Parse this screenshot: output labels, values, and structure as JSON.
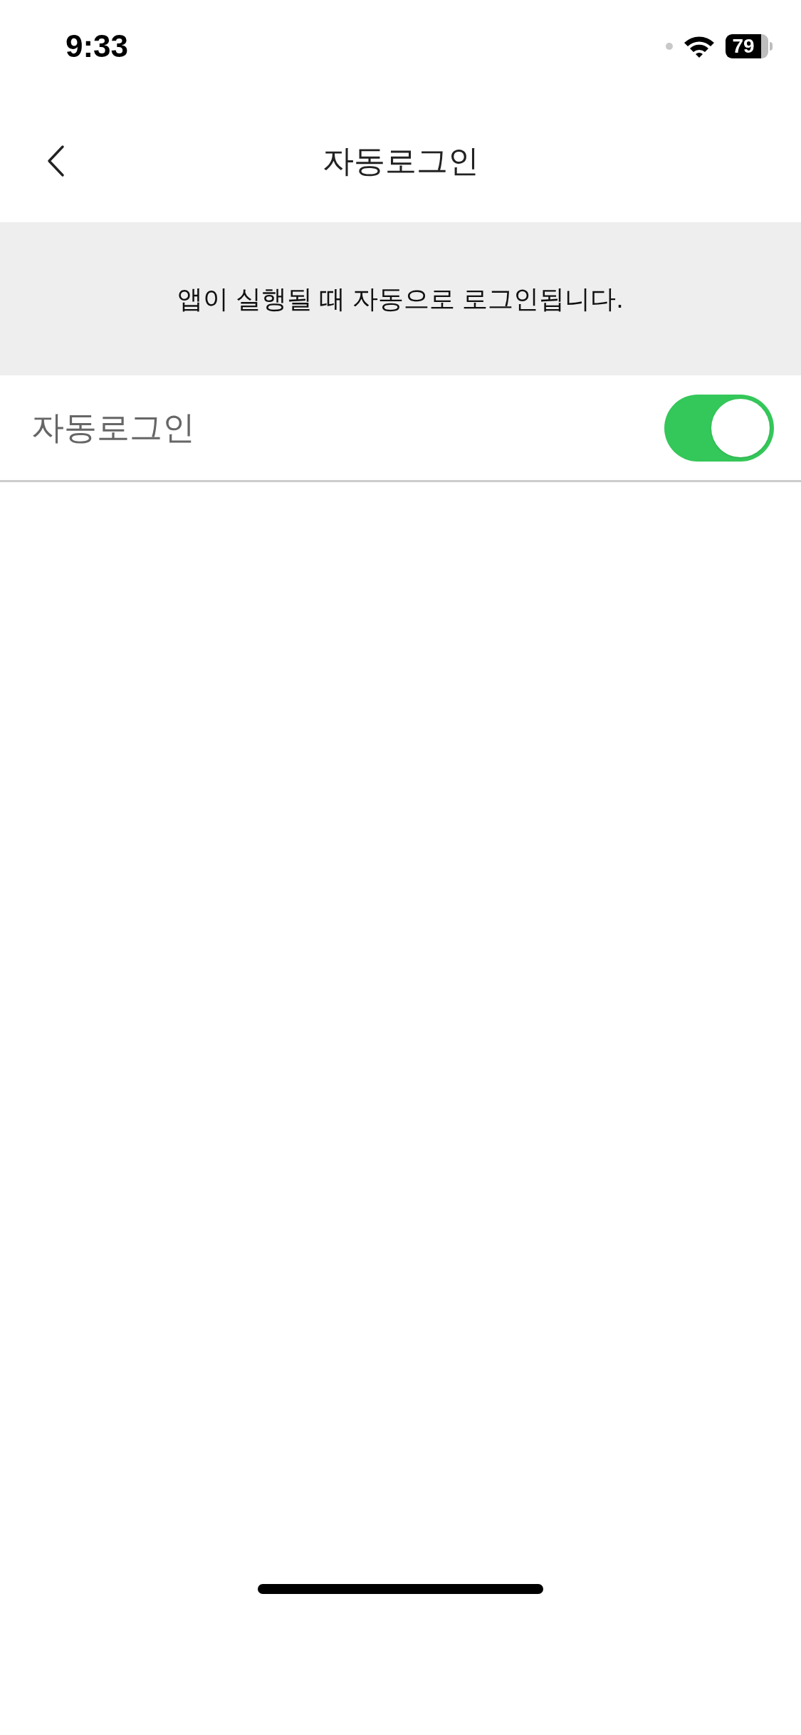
{
  "status_bar": {
    "time": "9:33",
    "battery": "79"
  },
  "nav": {
    "title": "자동로그인"
  },
  "banner": {
    "text": "앱이 실행될 때 자동으로 로그인됩니다."
  },
  "settings": [
    {
      "label": "자동로그인",
      "on": true
    }
  ]
}
